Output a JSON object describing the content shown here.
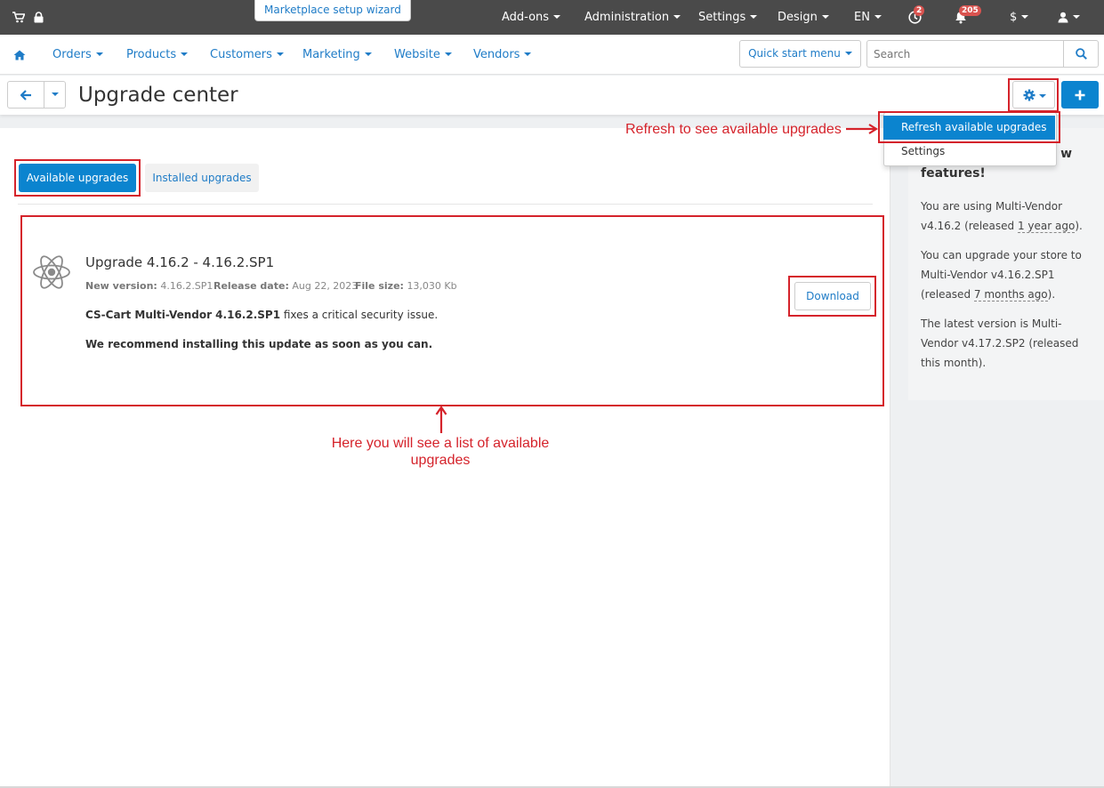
{
  "topbar": {
    "wizard_label": "Marketplace setup wizard",
    "menu": [
      {
        "label": "Add-ons"
      },
      {
        "label": "Administration"
      },
      {
        "label": "Settings"
      },
      {
        "label": "Design"
      },
      {
        "label": "EN"
      }
    ],
    "badge_clock": "2",
    "badge_bell": "205",
    "currency": "$",
    "icons": [
      "cart-icon",
      "lock-icon",
      "clock-icon",
      "bell-icon",
      "user-icon"
    ]
  },
  "nav": {
    "items": [
      {
        "label": "Orders"
      },
      {
        "label": "Products"
      },
      {
        "label": "Customers"
      },
      {
        "label": "Marketing"
      },
      {
        "label": "Website"
      },
      {
        "label": "Vendors"
      }
    ],
    "quick_start": "Quick start menu",
    "search_placeholder": "Search"
  },
  "page": {
    "title": "Upgrade center"
  },
  "dropdown": {
    "refresh": "Refresh available upgrades",
    "settings": "Settings"
  },
  "tabs": {
    "available": "Available upgrades",
    "installed": "Installed upgrades"
  },
  "upgrade": {
    "title": "Upgrade 4.16.2 - 4.16.2.SP1",
    "new_version_label": "New version:",
    "new_version": "4.16.2.SP1",
    "release_date_label": "Release date:",
    "release_date": "Aug 22, 2023",
    "file_size_label": "File size:",
    "file_size": "13,030 Kb",
    "desc_bold": "CS-Cart Multi-Vendor 4.16.2.SP1",
    "desc_rest": " fixes a critical security issue.",
    "recommendation": "We recommend installing this update as soon as you can.",
    "download": "Download"
  },
  "sidebar": {
    "heading_visible": "w",
    "heading_line2": "features!",
    "p1_a": "You are using Multi-Vendor v4.16.2 (released ",
    "p1_link": "1 year ago",
    "p1_b": ").",
    "p2_a": "You can upgrade your store to Multi-Vendor v4.16.2.SP1 (released ",
    "p2_link": "7 months ago",
    "p2_b": ").",
    "p3": "The latest version is Multi-Vendor v4.17.2.SP2 (released this month)."
  },
  "annotations": {
    "refresh": "Refresh to see available upgrades",
    "list_line1": "Here you will see a list of available",
    "list_line2": "upgrades"
  },
  "colors": {
    "topbar": "#4a4a4a",
    "primary": "#0b84cf",
    "link": "#1f7cc7",
    "annotation": "#d5232b",
    "badge": "#d9534f"
  }
}
